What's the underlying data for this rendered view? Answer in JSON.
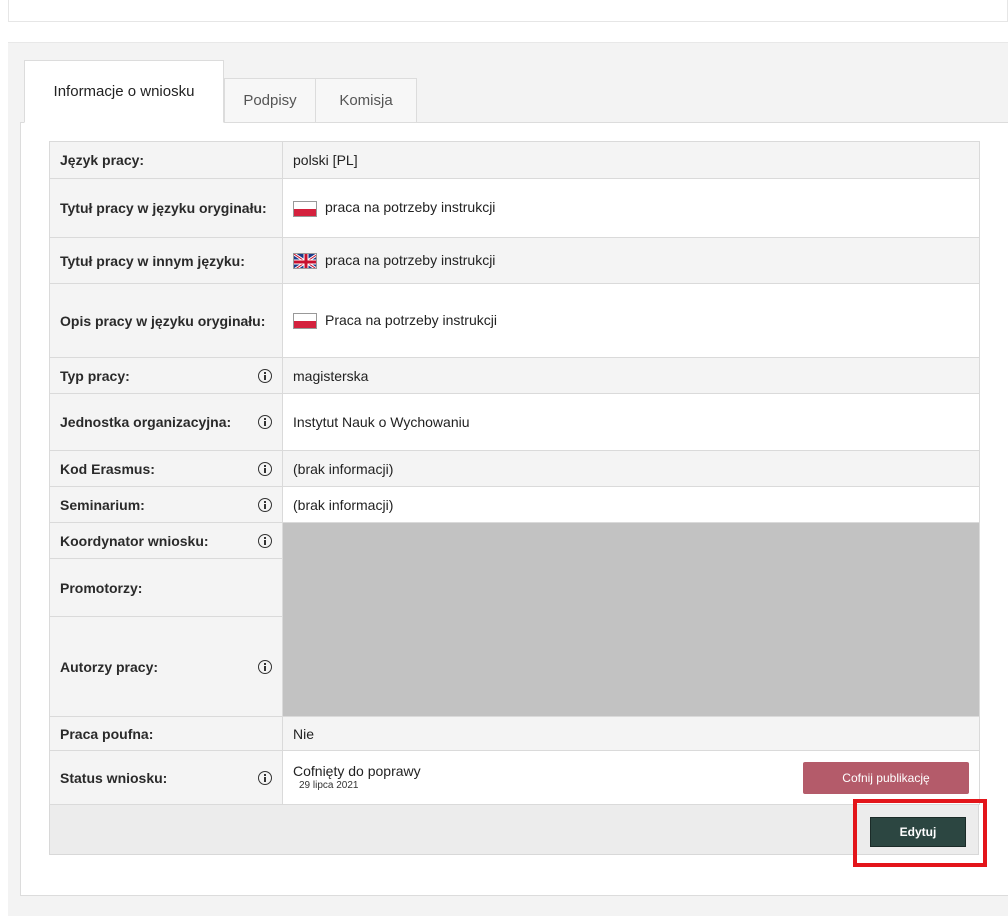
{
  "tabs": [
    {
      "label": "Informacje o wniosku"
    },
    {
      "label": "Podpisy"
    },
    {
      "label": "Komisja"
    }
  ],
  "rows": {
    "language": {
      "label": "Język pracy:",
      "value": "polski [PL]"
    },
    "title_orig": {
      "label": "Tytuł pracy w języku oryginału:",
      "value": "praca na potrzeby instrukcji",
      "flag": "pl-flag-icon"
    },
    "title_other": {
      "label": "Tytuł pracy w innym języku:",
      "value": "praca na potrzeby instrukcji",
      "flag": "uk-flag-icon"
    },
    "desc_orig": {
      "label": "Opis pracy w języku oryginału:",
      "value": "Praca na potrzeby instrukcji",
      "flag": "pl-flag-icon"
    },
    "type": {
      "label": "Typ pracy:",
      "value": "magisterska"
    },
    "unit": {
      "label": "Jednostka organizacyjna:",
      "value": "Instytut Nauk o Wychowaniu"
    },
    "erasmus": {
      "label": "Kod Erasmus:",
      "value": "(brak informacji)"
    },
    "seminar": {
      "label": "Seminarium:",
      "value": "(brak informacji)"
    },
    "coordinator": {
      "label": "Koordynator wniosku:"
    },
    "promoters": {
      "label": "Promotorzy:"
    },
    "authors": {
      "label": "Autorzy pracy:"
    },
    "confidential": {
      "label": "Praca poufna:",
      "value": "Nie"
    },
    "status": {
      "label": "Status wniosku:",
      "value": "Cofnięty do poprawy",
      "date": "29 lipca 2021"
    }
  },
  "buttons": {
    "revoke": "Cofnij publikację",
    "edit": "Edytuj"
  },
  "colors": {
    "revoke_button": "#b45b6a",
    "edit_button": "#2c4641",
    "highlight": "#e3151a",
    "no_info_text": "#c0622a",
    "redacted": "#c2c2c2"
  }
}
